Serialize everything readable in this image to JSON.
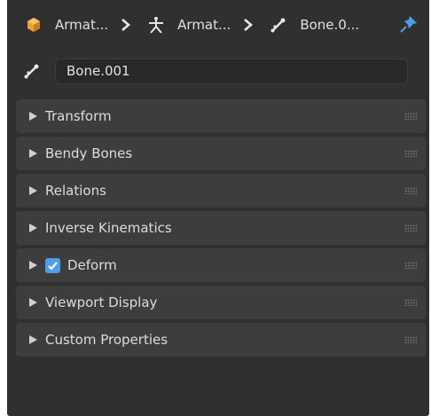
{
  "breadcrumb": {
    "items": [
      {
        "label": "Armat...",
        "icon": "object-cube-icon"
      },
      {
        "label": "Armat...",
        "icon": "armature-icon"
      },
      {
        "label": "Bone.0...",
        "icon": "bone-icon"
      }
    ],
    "pin_icon": "pin-icon"
  },
  "bone_name": {
    "value": "Bone.001",
    "icon": "bone-icon"
  },
  "panels": [
    {
      "label": "Transform",
      "expanded": false
    },
    {
      "label": "Bendy Bones",
      "expanded": false
    },
    {
      "label": "Relations",
      "expanded": false
    },
    {
      "label": "Inverse Kinematics",
      "expanded": false
    },
    {
      "label": "Deform",
      "expanded": false,
      "checkbox": true
    },
    {
      "label": "Viewport Display",
      "expanded": false
    },
    {
      "label": "Custom Properties",
      "expanded": false
    }
  ],
  "colors": {
    "background": "#303030",
    "panel": "#3d3d3d",
    "field": "#282828",
    "accent": "#4d9ee8",
    "object_icon": "#f0a030",
    "pin_icon": "#4d9ee8"
  }
}
